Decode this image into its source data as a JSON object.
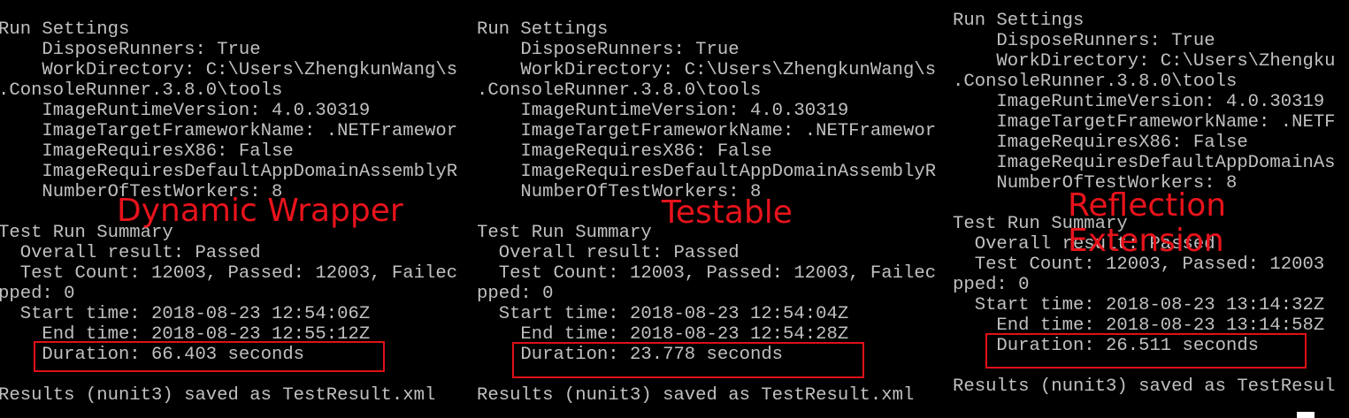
{
  "panels": [
    {
      "label": "Dynamic Wrapper",
      "lines": [
        "Run Settings",
        "    DisposeRunners: True",
        "    WorkDirectory: C:\\Users\\ZhengkunWang\\s",
        ".ConsoleRunner.3.8.0\\tools",
        "    ImageRuntimeVersion: 4.0.30319",
        "    ImageTargetFrameworkName: .NETFramewor",
        "    ImageRequiresX86: False",
        "    ImageRequiresDefaultAppDomainAssemblyR",
        "    NumberOfTestWorkers: 8",
        "",
        "Test Run Summary",
        "  Overall result: Passed",
        "  Test Count: 12003, Passed: 12003, Failec",
        "pped: 0",
        "  Start time: 2018-08-23 12:54:06Z",
        "    End time: 2018-08-23 12:55:12Z",
        "    Duration: 66.403 seconds",
        "",
        "Results (nunit3) saved as TestResult.xml"
      ]
    },
    {
      "label": "Testable",
      "lines": [
        "Run Settings",
        "    DisposeRunners: True",
        "    WorkDirectory: C:\\Users\\ZhengkunWang\\s",
        ".ConsoleRunner.3.8.0\\tools",
        "    ImageRuntimeVersion: 4.0.30319",
        "    ImageTargetFrameworkName: .NETFramewor",
        "    ImageRequiresX86: False",
        "    ImageRequiresDefaultAppDomainAssemblyR",
        "    NumberOfTestWorkers: 8",
        "",
        "Test Run Summary",
        "  Overall result: Passed",
        "  Test Count: 12003, Passed: 12003, Failec",
        "pped: 0",
        "  Start time: 2018-08-23 12:54:04Z",
        "    End time: 2018-08-23 12:54:28Z",
        "    Duration: 23.778 seconds",
        "",
        "Results (nunit3) saved as TestResult.xml"
      ]
    },
    {
      "label": "Reflection\nExtension",
      "lines": [
        "Run Settings",
        "    DisposeRunners: True",
        "    WorkDirectory: C:\\Users\\Zhengku",
        ".ConsoleRunner.3.8.0\\tools",
        "    ImageRuntimeVersion: 4.0.30319",
        "    ImageTargetFrameworkName: .NETF",
        "    ImageRequiresX86: False",
        "    ImageRequiresDefaultAppDomainAs",
        "    NumberOfTestWorkers: 8",
        "",
        "Test Run Summary",
        "  Overall result: Passed",
        "  Test Count: 12003, Passed: 12003",
        "pped: 0",
        "  Start time: 2018-08-23 13:14:32Z",
        "    End time: 2018-08-23 13:14:58Z",
        "    Duration: 26.511 seconds",
        "",
        "Results (nunit3) saved as TestResul"
      ]
    }
  ]
}
